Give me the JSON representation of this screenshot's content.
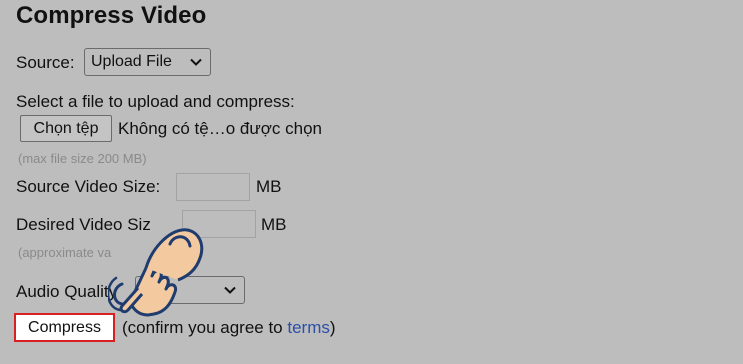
{
  "title": "Compress Video",
  "source": {
    "label": "Source:",
    "selected": "Upload File"
  },
  "upload": {
    "prompt": "Select a file to upload and compress:",
    "choose_button": "Chọn tệp",
    "no_file_text": "Không có tệ…o được chọn",
    "max_size_hint": "(max file size 200 MB)"
  },
  "source_size": {
    "label": "Source Video Size:",
    "unit": "MB"
  },
  "desired_size": {
    "label": "Desired Video Siz",
    "unit": "MB",
    "hint": "(approximate va"
  },
  "audio": {
    "label": "Audio Quality",
    "selected": "Au"
  },
  "compress": {
    "button": "Compress",
    "confirm_before": "(confirm you agree to ",
    "terms_link": "terms",
    "confirm_after": ")"
  },
  "colors": {
    "background": "#bdbdbd",
    "highlight_border": "#d92020",
    "link": "#2b4fa8"
  },
  "icons": {
    "select_chevron": "chevron-down-icon",
    "pointer": "hand-pointer-icon"
  }
}
